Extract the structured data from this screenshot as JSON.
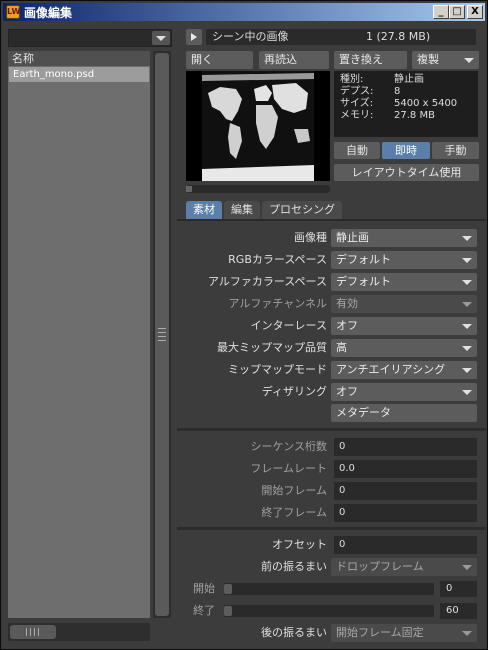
{
  "window": {
    "title": "画像編集",
    "app_icon_text": "LW",
    "controls": {
      "minimize": "_",
      "maximize": "□",
      "close": "X"
    }
  },
  "left": {
    "filter_value": "",
    "list_header": "名称",
    "items": [
      "Earth_mono.psd"
    ]
  },
  "header": {
    "scene_label": "シーン中の画像",
    "scene_value": "1 (27.8 MB)"
  },
  "toolbar": {
    "open": "開く",
    "reload": "再読込",
    "replace": "置き換え",
    "clone": "複製"
  },
  "info": {
    "rows": [
      {
        "key": "種別:",
        "value": "静止画"
      },
      {
        "key": "デプス:",
        "value": "8"
      },
      {
        "key": "サイズ:",
        "value": "5400 x 5400"
      },
      {
        "key": "メモリ:",
        "value": "27.8 MB"
      }
    ]
  },
  "update_modes": {
    "auto": "自動",
    "immediate": "即時",
    "manual": "手動",
    "active": "immediate"
  },
  "layout_time_button": "レイアウトタイム使用",
  "tabs": [
    {
      "label": "素材",
      "active": true
    },
    {
      "label": "編集",
      "active": false
    },
    {
      "label": "プロセシング",
      "active": false
    }
  ],
  "properties": [
    {
      "label": "画像種",
      "value": "静止画",
      "enabled": true
    },
    {
      "label": "RGBカラースペース",
      "value": "デフォルト",
      "enabled": true
    },
    {
      "label": "アルファカラースペース",
      "value": "デフォルト",
      "enabled": true
    },
    {
      "label": "アルファチャンネル",
      "value": "有効",
      "enabled": false
    },
    {
      "label": "インターレース",
      "value": "オフ",
      "enabled": true
    },
    {
      "label": "最大ミップマップ品質",
      "value": "高",
      "enabled": true
    },
    {
      "label": "ミップマップモード",
      "value": "アンチエイリアシング",
      "enabled": true
    },
    {
      "label": "ディザリング",
      "value": "オフ",
      "enabled": true
    }
  ],
  "metadata_button": "メタデータ",
  "sequence": {
    "digits": {
      "label": "シーケンス桁数",
      "value": "0"
    },
    "frame_rate": {
      "label": "フレームレート",
      "value": "0.0"
    },
    "start_frame": {
      "label": "開始フレーム",
      "value": "0"
    },
    "end_frame": {
      "label": "終了フレーム",
      "value": "0"
    }
  },
  "timing": {
    "offset": {
      "label": "オフセット",
      "value": "0"
    },
    "pre_behavior": {
      "label": "前の振るまい",
      "value": "ドロップフレーム"
    },
    "start": {
      "label": "開始",
      "value": "0"
    },
    "end": {
      "label": "終了",
      "value": "60"
    },
    "post_behavior": {
      "label": "後の振るまい",
      "value": "開始フレーム固定"
    }
  },
  "colors": {
    "accent": "#5a7fa8",
    "titlebar_start": "#0a246a",
    "titlebar_end": "#a6caf0",
    "panel_bg": "#3c3c3c"
  }
}
